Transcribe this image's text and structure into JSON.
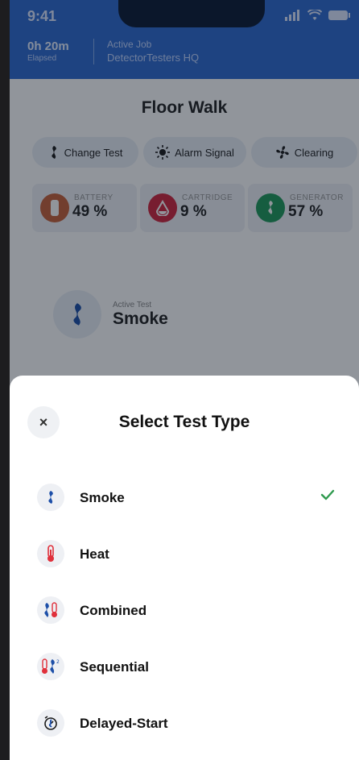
{
  "status_bar": {
    "time": "9:41"
  },
  "header": {
    "elapsed_value": "0h 20m",
    "elapsed_label": "Elapsed",
    "active_job_label": "Active Job",
    "active_job_name": "DetectorTesters HQ"
  },
  "page": {
    "title": "Floor Walk",
    "actions": [
      {
        "label": "Change Test",
        "icon": "smoke-icon"
      },
      {
        "label": "Alarm Signal",
        "icon": "alarm-icon"
      },
      {
        "label": "Clearing",
        "icon": "fan-icon"
      }
    ],
    "stats": [
      {
        "label": "BATTERY",
        "value": "49 %",
        "color": "#c7613a",
        "icon": "battery-icon"
      },
      {
        "label": "CARTRIDGE",
        "value": "9 %",
        "color": "#d0263d",
        "icon": "cartridge-icon"
      },
      {
        "label": "GENERATOR",
        "value": "57 %",
        "color": "#1f9a5a",
        "icon": "generator-icon"
      }
    ],
    "active_test": {
      "label": "Active Test",
      "name": "Smoke"
    }
  },
  "sheet": {
    "close": "×",
    "title": "Select Test Type",
    "selected": "Smoke",
    "options": [
      {
        "label": "Smoke",
        "icon": "smoke-icon"
      },
      {
        "label": "Heat",
        "icon": "thermometer-icon"
      },
      {
        "label": "Combined",
        "icon": "combined-icon"
      },
      {
        "label": "Sequential",
        "icon": "sequential-icon"
      },
      {
        "label": "Delayed-Start",
        "icon": "timer-icon"
      }
    ]
  },
  "colors": {
    "brand": "#2f6bd0",
    "smoke_blue": "#1d4fa8",
    "heat_red": "#e0303b",
    "check_green": "#2f9a4e"
  }
}
